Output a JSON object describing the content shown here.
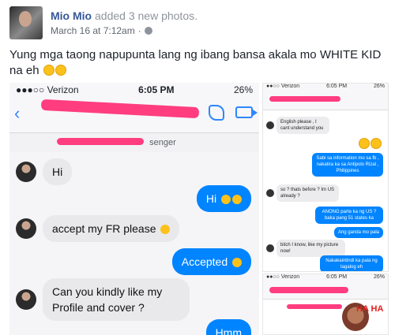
{
  "post": {
    "author": "Mio Mio",
    "action": " added 3 new photos.",
    "timestamp": "March 16 at 7:12am",
    "separator": "·",
    "text": "Yung mga taong napupunta lang ng ibang bansa akala mo WHITE KID na eh"
  },
  "main_photo": {
    "carrier": "●●●○○ Verizon",
    "time": "6:05 PM",
    "battery": "26%",
    "subtitle": "senger",
    "messages": [
      {
        "dir": "in",
        "text": "Hi"
      },
      {
        "dir": "out",
        "text": "Hi"
      },
      {
        "dir": "in",
        "text": "accept my FR please"
      },
      {
        "dir": "out",
        "text": "Accepted"
      },
      {
        "dir": "in",
        "text": "Can you kindly like my Profile and cover ?"
      },
      {
        "dir": "out",
        "text": "Hmm"
      }
    ]
  },
  "side_photo_1": {
    "carrier": "●●○○ Verizon",
    "time": "6:05 PM",
    "battery": "26%",
    "messages": [
      {
        "dir": "in",
        "text": "English please , I cant understand you"
      },
      {
        "dir": "out",
        "text": "Sabi sa information mo sa fb , nakatira ka sa Antipolo Rizal , Philippines"
      },
      {
        "dir": "in",
        "text": "so ? thats before ? Im US already ?"
      },
      {
        "dir": "out",
        "text": "ANONG parte ka ng US ? baka pang 51 states ka"
      },
      {
        "dir": "out",
        "text": "Ang ganda mo pala"
      },
      {
        "dir": "in",
        "text": "bitch I know, like my picture now!"
      },
      {
        "dir": "out",
        "text": "Nakakaintindi ka pala ng tagalog eh"
      }
    ]
  },
  "side_photo_2": {
    "carrier": "●●○○ Verizon",
    "time": "6:05 PM",
    "battery": "26%",
    "sticker_text": "HA HA"
  },
  "colors": {
    "link": "#365899",
    "messenger_blue": "#0084ff",
    "redaction_pink": "#ff3d7f"
  }
}
